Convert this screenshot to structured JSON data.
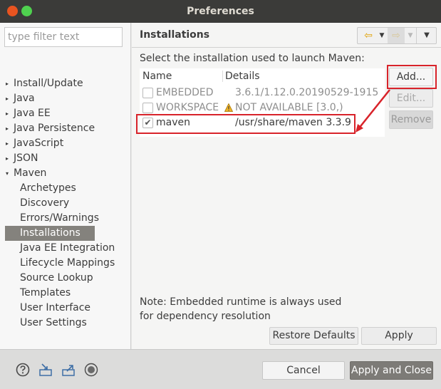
{
  "window": {
    "title": "Preferences"
  },
  "sidebar": {
    "filter_placeholder": "type filter text",
    "tree": [
      {
        "label": "Install/Update",
        "arrow": "▸",
        "level": 0
      },
      {
        "label": "Java",
        "arrow": "▸",
        "level": 0
      },
      {
        "label": "Java EE",
        "arrow": "▸",
        "level": 0
      },
      {
        "label": "Java Persistence",
        "arrow": "▸",
        "level": 0
      },
      {
        "label": "JavaScript",
        "arrow": "▸",
        "level": 0
      },
      {
        "label": "JSON",
        "arrow": "▸",
        "level": 0
      },
      {
        "label": "Maven",
        "arrow": "▾",
        "level": 0
      },
      {
        "label": "Archetypes",
        "level": 1
      },
      {
        "label": "Discovery",
        "level": 1
      },
      {
        "label": "Errors/Warnings",
        "level": 1
      },
      {
        "label": "Installations",
        "level": 1,
        "selected": true
      },
      {
        "label": "Java EE Integration",
        "level": 1
      },
      {
        "label": "Lifecycle Mappings",
        "level": 1
      },
      {
        "label": "Source Lookup",
        "level": 1
      },
      {
        "label": "Templates",
        "level": 1
      },
      {
        "label": "User Interface",
        "level": 1
      },
      {
        "label": "User Settings",
        "level": 1
      }
    ]
  },
  "page": {
    "title": "Installations",
    "description": "Select the installation used to launch Maven:",
    "columns": {
      "name": "Name",
      "details": "Details"
    },
    "rows": [
      {
        "name": "EMBEDDED",
        "details": "3.6.1/1.12.0.20190529-1915",
        "checked": false,
        "enabled": false
      },
      {
        "name": "WORKSPACE",
        "details": "NOT AVAILABLE [3.0,)",
        "checked": false,
        "enabled": false,
        "icon": "warning-icon"
      },
      {
        "name": "maven",
        "details": "/usr/share/maven 3.3.9",
        "checked": true,
        "enabled": true
      }
    ],
    "buttons": {
      "add": "Add...",
      "edit": "Edit...",
      "remove": "Remove"
    },
    "note": "Note: Embedded runtime is always used for dependency resolution",
    "restore_defaults": "Restore Defaults",
    "apply": "Apply",
    "nav": {
      "back_icon": "back-arrow-icon",
      "forward_icon": "forward-arrow-icon",
      "menu_icon": "view-menu-icon"
    }
  },
  "footer": {
    "icons": [
      "help-icon",
      "import-icon",
      "export-icon",
      "record-icon"
    ],
    "cancel": "Cancel",
    "apply_and_close": "Apply and Close"
  },
  "colors": {
    "accent_highlight": "#d8232a",
    "selection": "#84827d",
    "titlebar": "#3b3b39"
  }
}
